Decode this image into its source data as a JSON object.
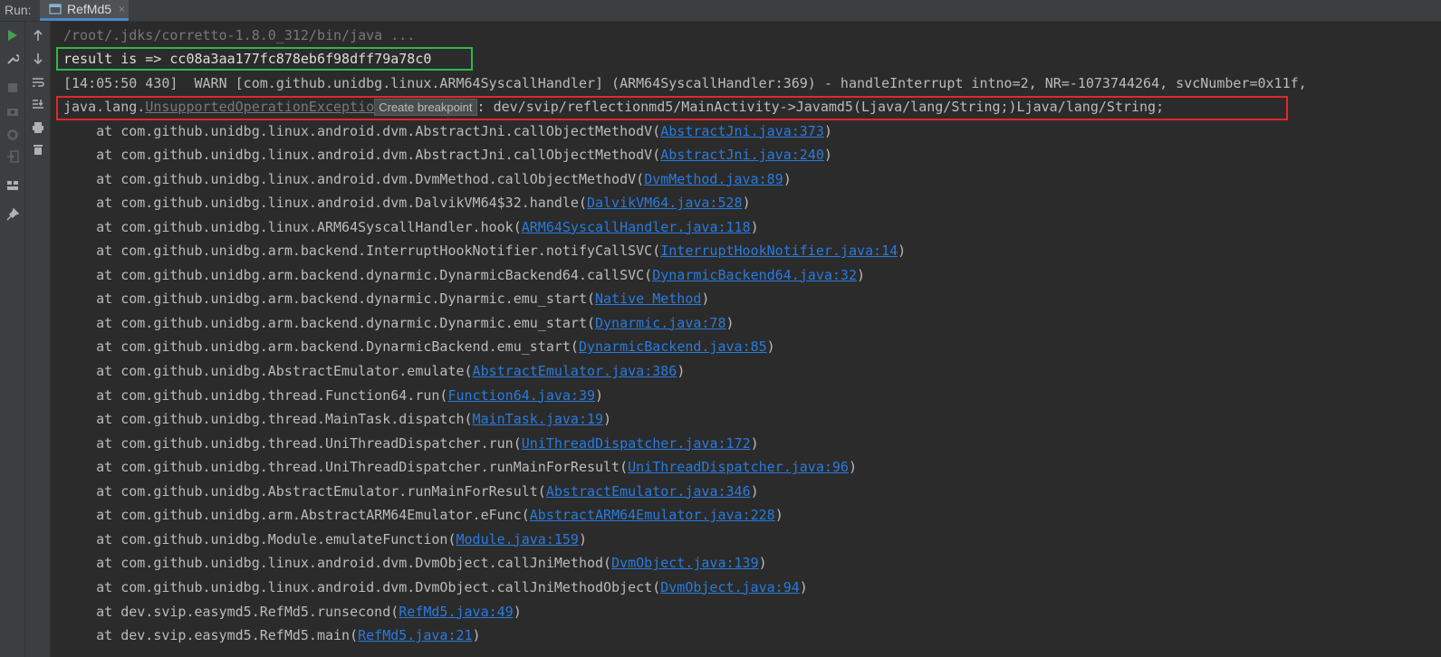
{
  "run_label": "Run:",
  "tab": {
    "label": "RefMd5",
    "close": "×"
  },
  "console": {
    "cmd": "/root/.jdks/corretto-1.8.0_312/bin/java ...",
    "result": "result is => cc08a3aa177fc878eb6f98dff79a78c0",
    "warn": "[14:05:50 430]  WARN [com.github.unidbg.linux.ARM64SyscallHandler] (ARM64SyscallHandler:369) - handleInterrupt intno=2, NR=-1073744264, svcNumber=0x11f,",
    "exception": {
      "prefix": "java.lang.",
      "class": "UnsupportedOperationExceptio",
      "tooltip": "Create breakpoint",
      "message": ": dev/svip/reflectionmd5/MainActivity->Javamd5(Ljava/lang/String;)Ljava/lang/String;"
    },
    "stack": [
      {
        "text": "    at com.github.unidbg.linux.android.dvm.AbstractJni.callObjectMethodV(",
        "link": "AbstractJni.java:373",
        "end": ")"
      },
      {
        "text": "    at com.github.unidbg.linux.android.dvm.AbstractJni.callObjectMethodV(",
        "link": "AbstractJni.java:240",
        "end": ")"
      },
      {
        "text": "    at com.github.unidbg.linux.android.dvm.DvmMethod.callObjectMethodV(",
        "link": "DvmMethod.java:89",
        "end": ")"
      },
      {
        "text": "    at com.github.unidbg.linux.android.dvm.DalvikVM64$32.handle(",
        "link": "DalvikVM64.java:528",
        "end": ")"
      },
      {
        "text": "    at com.github.unidbg.linux.ARM64SyscallHandler.hook(",
        "link": "ARM64SyscallHandler.java:118",
        "end": ")"
      },
      {
        "text": "    at com.github.unidbg.arm.backend.InterruptHookNotifier.notifyCallSVC(",
        "link": "InterruptHookNotifier.java:14",
        "end": ")"
      },
      {
        "text": "    at com.github.unidbg.arm.backend.dynarmic.DynarmicBackend64.callSVC(",
        "link": "DynarmicBackend64.java:32",
        "end": ")"
      },
      {
        "text": "    at com.github.unidbg.arm.backend.dynarmic.Dynarmic.emu_start(",
        "link": "Native Method",
        "end": ")"
      },
      {
        "text": "    at com.github.unidbg.arm.backend.dynarmic.Dynarmic.emu_start(",
        "link": "Dynarmic.java:78",
        "end": ")"
      },
      {
        "text": "    at com.github.unidbg.arm.backend.DynarmicBackend.emu_start(",
        "link": "DynarmicBackend.java:85",
        "end": ")"
      },
      {
        "text": "    at com.github.unidbg.AbstractEmulator.emulate(",
        "link": "AbstractEmulator.java:386",
        "end": ")"
      },
      {
        "text": "    at com.github.unidbg.thread.Function64.run(",
        "link": "Function64.java:39",
        "end": ")"
      },
      {
        "text": "    at com.github.unidbg.thread.MainTask.dispatch(",
        "link": "MainTask.java:19",
        "end": ")"
      },
      {
        "text": "    at com.github.unidbg.thread.UniThreadDispatcher.run(",
        "link": "UniThreadDispatcher.java:172",
        "end": ")"
      },
      {
        "text": "    at com.github.unidbg.thread.UniThreadDispatcher.runMainForResult(",
        "link": "UniThreadDispatcher.java:96",
        "end": ")"
      },
      {
        "text": "    at com.github.unidbg.AbstractEmulator.runMainForResult(",
        "link": "AbstractEmulator.java:346",
        "end": ")"
      },
      {
        "text": "    at com.github.unidbg.arm.AbstractARM64Emulator.eFunc(",
        "link": "AbstractARM64Emulator.java:228",
        "end": ")"
      },
      {
        "text": "    at com.github.unidbg.Module.emulateFunction(",
        "link": "Module.java:159",
        "end": ")"
      },
      {
        "text": "    at com.github.unidbg.linux.android.dvm.DvmObject.callJniMethod(",
        "link": "DvmObject.java:139",
        "end": ")"
      },
      {
        "text": "    at com.github.unidbg.linux.android.dvm.DvmObject.callJniMethodObject(",
        "link": "DvmObject.java:94",
        "end": ")"
      },
      {
        "text": "    at dev.svip.easymd5.RefMd5.runsecond(",
        "link": "RefMd5.java:49",
        "end": ")"
      },
      {
        "text": "    at dev.svip.easymd5.RefMd5.main(",
        "link": "RefMd5.java:21",
        "end": ")"
      }
    ]
  },
  "colors": {
    "link": "#287bde",
    "highlight_green": "#2fb84a",
    "highlight_red": "#e3262c",
    "run_icon": "#499c54"
  },
  "icons": {
    "gutter_left": [
      "run-icon",
      "wrench-icon",
      "stop-icon",
      "camera-icon",
      "settings-icon",
      "exit-icon",
      "layout-icon",
      "pin-icon"
    ],
    "gutter_right": [
      "arrow-up-icon",
      "arrow-down-icon",
      "soft-wrap-icon",
      "scroll-to-end-icon",
      "print-icon",
      "trash-icon"
    ]
  }
}
